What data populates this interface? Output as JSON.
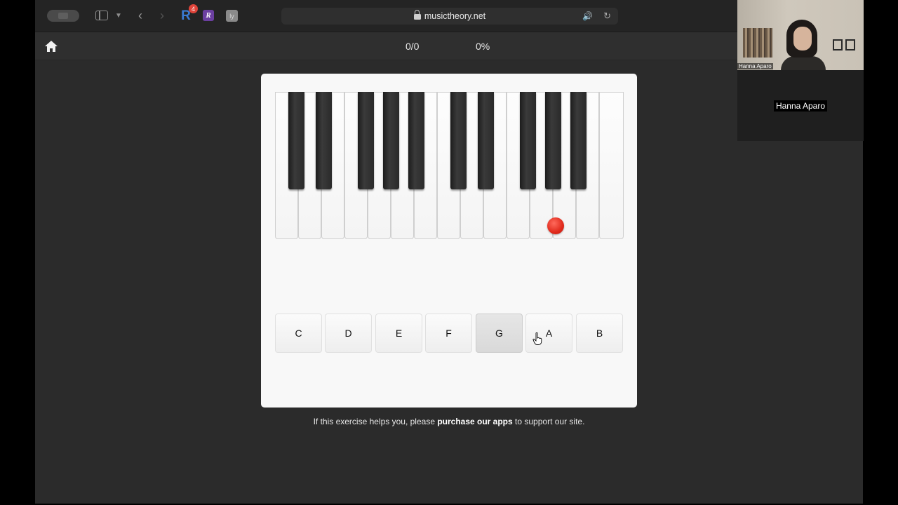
{
  "browser": {
    "url": "musictheory.net",
    "extension_badge_count": "4",
    "extension_icons": [
      "r-extension-icon",
      "rk-extension-icon",
      "ly-extension-icon"
    ]
  },
  "exercise": {
    "score": "0/0",
    "percent": "0%",
    "marked_note_position": "G (sixth white key from left)",
    "answer_labels": [
      "C",
      "D",
      "E",
      "F",
      "G",
      "A",
      "B"
    ],
    "hovered_answer": "G",
    "footer_prefix": "If this exercise helps you, please ",
    "footer_link": "purchase our apps",
    "footer_suffix": " to support our site."
  },
  "video": {
    "participant_name": "Hanna Aparo",
    "tile_label": "Hanna Aparo"
  },
  "colors": {
    "marker": "#e02a1c",
    "page_bg": "#2b2b2b",
    "card_bg": "#f8f8f8",
    "accent_blue": "#4a90e2"
  }
}
